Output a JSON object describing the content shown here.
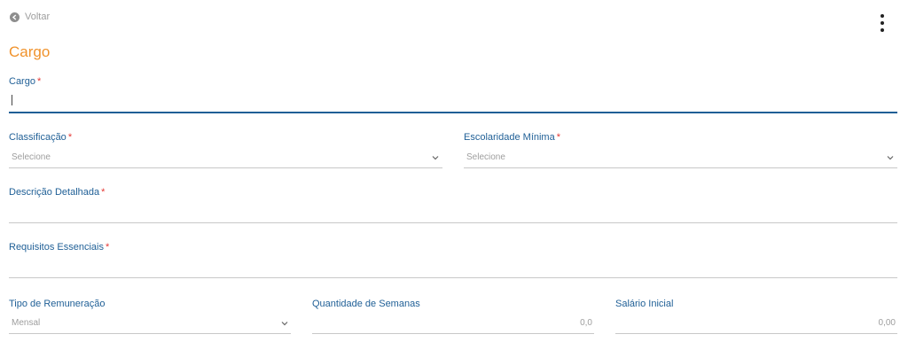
{
  "header": {
    "back_label": "Voltar",
    "menu_icon": "kebab-menu-icon"
  },
  "page_title": "Cargo",
  "colors": {
    "accent": "#f0922b",
    "label": "#1f5f96",
    "required": "#e53935",
    "line": "#c8c8c8"
  },
  "fields": {
    "cargo": {
      "label": "Cargo",
      "required_mark": "*",
      "value": ""
    },
    "classificacao": {
      "label": "Classificação",
      "required_mark": "*",
      "value": "Selecione"
    },
    "escolaridade": {
      "label": "Escolaridade Mínima",
      "required_mark": "*",
      "value": "Selecione"
    },
    "descricao": {
      "label": "Descrição Detalhada",
      "required_mark": "*",
      "value": ""
    },
    "requisitos": {
      "label": "Requisitos Essenciais",
      "required_mark": "*",
      "value": ""
    },
    "remuneracao": {
      "label": "Tipo de Remuneração",
      "value": "Mensal"
    },
    "semanas": {
      "label": "Quantidade de Semanas",
      "value": "0,0"
    },
    "salario": {
      "label": "Salário Inicial",
      "value": "0,00"
    }
  }
}
